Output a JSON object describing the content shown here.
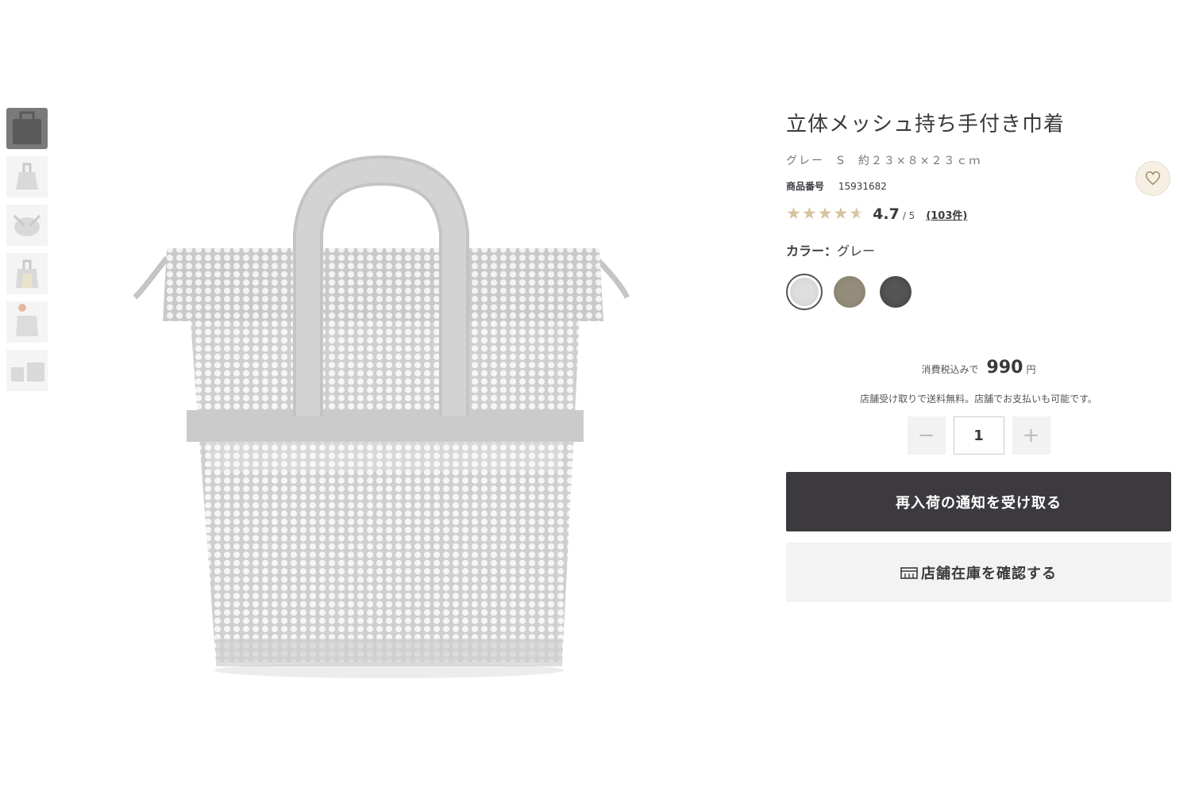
{
  "product": {
    "title": "立体メッシュ持ち手付き巾着",
    "variant": "グレー　S　約２３×８×２３ｃｍ",
    "code_label": "商品番号",
    "code": "15931682",
    "rating": "4.7",
    "rating_max": "/ 5",
    "reviews": "(103件)",
    "rating_fraction": 0.94
  },
  "color": {
    "label": "カラー：",
    "selected": "グレー",
    "swatches": [
      {
        "name": "grey",
        "hex": "#d5d5d5"
      },
      {
        "name": "khaki",
        "hex": "#8c8474"
      },
      {
        "name": "dark-grey",
        "hex": "#4a4a4a"
      }
    ]
  },
  "price": {
    "prefix": "消費税込みで",
    "value": "990",
    "unit": "円",
    "ship_note": "店舗受け取りで送料無料。店舗でお支払いも可能です。"
  },
  "quantity": {
    "minus": "−",
    "value": "1",
    "plus": "+"
  },
  "buttons": {
    "restock": "再入荷の通知を受け取る",
    "store_stock": "店舗在庫を確認する"
  },
  "icons": {
    "favorite": "heart-icon",
    "store": "store-icon",
    "star": "★"
  },
  "colors": {
    "primary_button": "#3c3a3f",
    "star": "#d8c2a0"
  }
}
